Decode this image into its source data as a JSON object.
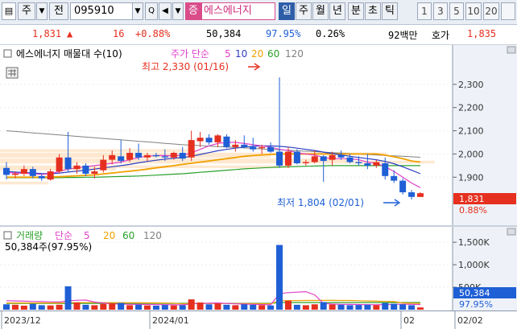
{
  "toolbar": {
    "market_code": "주",
    "jeon_label": "전",
    "stock_code": "095910",
    "jeung_label": "증",
    "stock_name": "에스에너지",
    "periods": [
      "일",
      "주",
      "월",
      "년",
      "분",
      "초",
      "틱"
    ],
    "active_period": "일",
    "intervals": [
      "1",
      "3",
      "5",
      "10",
      "20"
    ]
  },
  "quote": {
    "price": "1,831",
    "change": "16",
    "change_pct": "+0.88%",
    "volume": "50,384",
    "volume_ratio": "97.95%",
    "turnover": "0.26%",
    "amount": "92백만",
    "ask_label": "호가",
    "ask_price": "1,835"
  },
  "colors": {
    "up": "#e5301f",
    "down": "#1f5fd6",
    "ma5": "#e040c8",
    "ma10": "#2b3dc2",
    "ma20": "#f0a000",
    "ma60": "#2aa02a",
    "ma120": "#808080"
  },
  "price_chart": {
    "title": "에스에너지 매물대 수(10)",
    "ma_label": "주가 단순",
    "ma_periods": [
      "5",
      "10",
      "20",
      "60",
      "120"
    ],
    "high_annotation": "최고 2,330 (01/16)",
    "low_annotation": "최저 1,804 (02/01)",
    "price_tag": "1,831",
    "pct_tag": "0.88%"
  },
  "volume_chart": {
    "title": "거래량",
    "ma_label": "단순",
    "ma_periods": [
      "5",
      "20",
      "60",
      "120"
    ],
    "info": "50,384주(97.95%)",
    "vol_tag": "50,384",
    "pct_tag": "97.95%"
  },
  "chart_data": [
    {
      "type": "candlestick",
      "title": "에스에너지 매물대 수(10)",
      "ylim": [
        1700,
        2400
      ],
      "y_ticks": [
        "2,300",
        "2,200",
        "2,100",
        "2,000",
        "1,900"
      ],
      "x_ticks": [
        "2023/12",
        "2024/01",
        "02",
        "02/02"
      ],
      "ohlc": [
        [
          1940,
          1965,
          1890,
          1910
        ],
        [
          1910,
          1925,
          1895,
          1915
        ],
        [
          1915,
          1950,
          1905,
          1935
        ],
        [
          1935,
          1945,
          1895,
          1905
        ],
        [
          1905,
          1915,
          1885,
          1895
        ],
        [
          1890,
          1935,
          1885,
          1925
        ],
        [
          1925,
          2000,
          1915,
          1985
        ],
        [
          1985,
          2095,
          1920,
          1935
        ],
        [
          1935,
          1965,
          1915,
          1950
        ],
        [
          1950,
          1960,
          1905,
          1915
        ],
        [
          1915,
          1945,
          1895,
          1925
        ],
        [
          1930,
          1995,
          1920,
          1975
        ],
        [
          1975,
          2015,
          1955,
          1995
        ],
        [
          1990,
          2060,
          1960,
          1970
        ],
        [
          1975,
          2025,
          1965,
          2005
        ],
        [
          2005,
          2045,
          1975,
          1985
        ],
        [
          1985,
          2005,
          1970,
          1995
        ],
        [
          1995,
          2005,
          1985,
          1990
        ],
        [
          1990,
          2020,
          1970,
          1985
        ],
        [
          1985,
          2010,
          1975,
          2005
        ],
        [
          2005,
          2030,
          1970,
          1980
        ],
        [
          1985,
          2100,
          1970,
          2060
        ],
        [
          2055,
          2095,
          2030,
          2070
        ],
        [
          2070,
          2085,
          2040,
          2050
        ],
        [
          2050,
          2085,
          2030,
          2080
        ],
        [
          2075,
          2085,
          2025,
          2030
        ],
        [
          2030,
          2060,
          2010,
          2040
        ],
        [
          2040,
          2080,
          2025,
          2030
        ],
        [
          2030,
          2070,
          2010,
          2020
        ],
        [
          2025,
          2040,
          2000,
          2030
        ],
        [
          2030,
          2050,
          2005,
          2010
        ],
        [
          2010,
          2330,
          1940,
          1950
        ],
        [
          1950,
          2030,
          1940,
          2010
        ],
        [
          2010,
          2020,
          1955,
          1960
        ],
        [
          1960,
          1975,
          1950,
          1965
        ],
        [
          1965,
          2015,
          1960,
          1990
        ],
        [
          1990,
          1995,
          1880,
          1970
        ],
        [
          1975,
          2010,
          1950,
          1995
        ],
        [
          1995,
          2015,
          1975,
          1985
        ],
        [
          1985,
          2000,
          1960,
          1965
        ],
        [
          1965,
          1990,
          1950,
          1960
        ],
        [
          1960,
          2000,
          1935,
          1950
        ],
        [
          1950,
          1975,
          1940,
          1965
        ],
        [
          1960,
          1985,
          1890,
          1905
        ],
        [
          1905,
          1930,
          1875,
          1885
        ],
        [
          1885,
          1895,
          1825,
          1835
        ],
        [
          1835,
          1845,
          1804,
          1815
        ],
        [
          1815,
          1835,
          1815,
          1831
        ]
      ],
      "ma5": [
        1920,
        1918,
        1917,
        1915,
        1912,
        1915,
        1925,
        1935,
        1940,
        1945,
        1950,
        1955,
        1960,
        1965,
        1975,
        1985,
        1990,
        1993,
        1993,
        1992,
        1995,
        2005,
        2020,
        2035,
        2045,
        2050,
        2050,
        2045,
        2040,
        2035,
        2030,
        2020,
        2015,
        2005,
        2000,
        1995,
        1985,
        1980,
        1980,
        1980,
        1975,
        1965,
        1960,
        1945,
        1925,
        1900,
        1875,
        1855
      ],
      "ma10": [
        1925,
        1922,
        1920,
        1918,
        1916,
        1915,
        1918,
        1922,
        1926,
        1930,
        1935,
        1940,
        1945,
        1950,
        1955,
        1962,
        1968,
        1973,
        1978,
        1982,
        1985,
        1990,
        1998,
        2006,
        2014,
        2020,
        2025,
        2030,
        2033,
        2035,
        2035,
        2033,
        2030,
        2025,
        2020,
        2015,
        2008,
        2002,
        1996,
        1990,
        1985,
        1980,
        1975,
        1968,
        1958,
        1945,
        1930,
        1915
      ],
      "ma20": [
        1900,
        1900,
        1900,
        1900,
        1900,
        1901,
        1902,
        1904,
        1906,
        1908,
        1910,
        1914,
        1918,
        1922,
        1926,
        1930,
        1935,
        1940,
        1945,
        1950,
        1955,
        1960,
        1965,
        1970,
        1975,
        1980,
        1985,
        1990,
        1993,
        1996,
        1998,
        2000,
        2000,
        2000,
        2000,
        2000,
        2000,
        2000,
        2000,
        2000,
        2000,
        2000,
        2000,
        1995,
        1988,
        1980,
        1970,
        1965
      ],
      "ma60": [
        1898,
        1898,
        1898,
        1898,
        1898,
        1898,
        1898,
        1899,
        1899,
        1900,
        1900,
        1901,
        1902,
        1903,
        1904,
        1905,
        1907,
        1909,
        1911,
        1913,
        1915,
        1918,
        1921,
        1924,
        1927,
        1930,
        1933,
        1936,
        1938,
        1940,
        1942,
        1944,
        1945,
        1946,
        1947,
        1948,
        1949,
        1950,
        1950,
        1950,
        1950,
        1950,
        1950,
        1950,
        1950,
        1950,
        1950,
        1950
      ],
      "ma120": [
        2100,
        2097,
        2094,
        2091,
        2088,
        2085,
        2082,
        2079,
        2076,
        2073,
        2070,
        2067,
        2064,
        2061,
        2058,
        2055,
        2052,
        2049,
        2046,
        2043,
        2040,
        2038,
        2036,
        2034,
        2032,
        2030,
        2028,
        2026,
        2024,
        2022,
        2020,
        2018,
        2016,
        2014,
        2012,
        2010,
        2008,
        2006,
        2004,
        2002,
        2000,
        1998,
        1996,
        1994,
        1992,
        1990,
        1988,
        1986
      ],
      "volume_profile": [
        [
          1935,
          12
        ],
        [
          1945,
          30
        ],
        [
          1965,
          45
        ],
        [
          1975,
          36
        ],
        [
          1990,
          28
        ],
        [
          2000,
          40
        ],
        [
          2015,
          20
        ],
        [
          1875,
          5
        ]
      ]
    },
    {
      "type": "bar",
      "title": "거래량",
      "ylim": [
        0,
        1700000
      ],
      "y_ticks": [
        "1,500K",
        "1,000K",
        "500K"
      ],
      "values": [
        120000,
        110000,
        90000,
        130000,
        100000,
        95000,
        110000,
        520000,
        160000,
        110000,
        100000,
        130000,
        140000,
        150000,
        100000,
        110000,
        95000,
        90000,
        105000,
        95000,
        100000,
        230000,
        160000,
        120000,
        140000,
        110000,
        100000,
        120000,
        110000,
        100000,
        95000,
        1440000,
        200000,
        110000,
        100000,
        120000,
        170000,
        115000,
        110000,
        100000,
        105000,
        110000,
        100000,
        150000,
        130000,
        120000,
        100000,
        50384
      ],
      "ma5": [
        200000,
        195000,
        190000,
        185000,
        180000,
        175000,
        170000,
        200000,
        210000,
        215000,
        170000,
        150000,
        130000,
        125000,
        120000,
        118000,
        116000,
        114000,
        112000,
        110000,
        108000,
        130000,
        140000,
        145000,
        150000,
        140000,
        130000,
        125000,
        120000,
        115000,
        110000,
        360000,
        380000,
        390000,
        400000,
        330000,
        140000,
        125000,
        120000,
        118000,
        115000,
        112000,
        110000,
        115000,
        120000,
        122000,
        120000,
        115000
      ],
      "ma20": [
        150000,
        150000,
        150000,
        150000,
        150000,
        150000,
        150000,
        155000,
        157000,
        158000,
        158000,
        157000,
        157000,
        156000,
        155000,
        154000,
        152000,
        150000,
        148000,
        146000,
        130000,
        135000,
        137000,
        138000,
        139000,
        138000,
        137000,
        136000,
        135000,
        134000,
        133000,
        200000,
        202000,
        204000,
        205000,
        206000,
        207000,
        207000,
        206000,
        205000,
        200000,
        195000,
        190000,
        185000,
        180000,
        150000,
        145000,
        140000
      ],
      "ma60": [
        140000,
        140000,
        140000,
        140000,
        140000,
        140000,
        140000,
        141000,
        141000,
        141000,
        141000,
        141000,
        141000,
        141000,
        141000,
        141000,
        141000,
        141000,
        141000,
        141000,
        142000,
        142000,
        142000,
        142000,
        142000,
        142000,
        142000,
        142000,
        142000,
        142000,
        142000,
        160000,
        160000,
        160000,
        160000,
        160000,
        160000,
        160000,
        160000,
        160000,
        160000,
        160000,
        160000,
        160000,
        160000,
        160000,
        160000,
        160000
      ]
    }
  ]
}
